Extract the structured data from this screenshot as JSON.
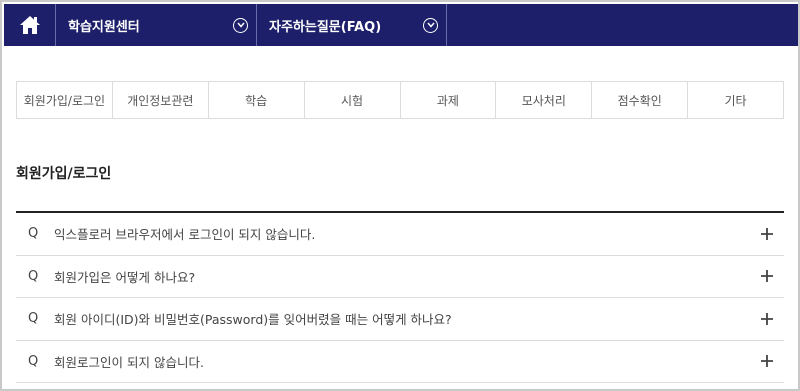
{
  "nav": {
    "home_icon": "home-icon",
    "menus": [
      {
        "label": "학습지원센터",
        "icon": "chevron-down-circle-icon"
      },
      {
        "label": "자주하는질문(FAQ)",
        "icon": "chevron-down-circle-icon"
      }
    ],
    "bg_color": "#1d1f6b"
  },
  "categories": [
    "회원가입/로그인",
    "개인정보관련",
    "학습",
    "시험",
    "과제",
    "모사처리",
    "점수확인",
    "기타"
  ],
  "section": {
    "title": "회원가입/로그인"
  },
  "faq": {
    "marker": "Q",
    "expand_icon": "plus-icon",
    "items": [
      "익스플로러 브라우저에서 로그인이 되지 않습니다.",
      "회원가입은 어떻게 하나요?",
      "회원 아이디(ID)와 비밀번호(Password)를 잊어버렸을 때는 어떻게 하나요?",
      "회원로그인이 되지 않습니다."
    ]
  }
}
